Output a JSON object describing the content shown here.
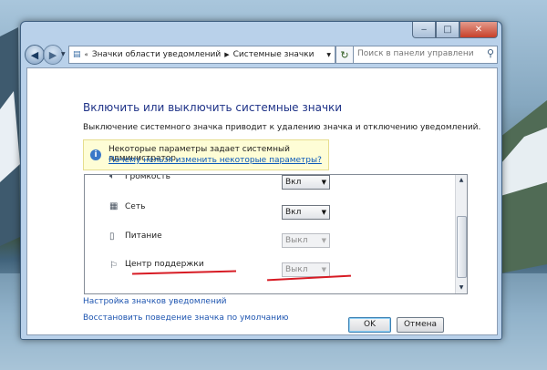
{
  "window": {
    "breadcrumb": [
      "Значки области уведомлений",
      "Системные значки"
    ],
    "search_placeholder": "Поиск в панели управления"
  },
  "page": {
    "title": "Включить или выключить системные значки",
    "description": "Выключение системного значка приводит к удалению значка и отключению уведомлений.",
    "info_text": "Некоторые параметры задает системный администратор.",
    "info_link": "Почему нельзя изменить некоторые параметры?"
  },
  "icons": {
    "volume": "speaker-icon",
    "network": "network-icon",
    "power": "battery-icon",
    "action_center": "flag-icon"
  },
  "items": [
    {
      "label": "Громкость",
      "value": "Вкл",
      "enabled": true
    },
    {
      "label": "Сеть",
      "value": "Вкл",
      "enabled": true
    },
    {
      "label": "Питание",
      "value": "Выкл",
      "enabled": false
    },
    {
      "label": "Центр поддержки",
      "value": "Выкл",
      "enabled": false
    }
  ],
  "links": {
    "configure": "Настройка значков уведомлений",
    "restore": "Восстановить поведение значка по умолчанию"
  },
  "buttons": {
    "ok": "OK",
    "cancel": "Отмена"
  },
  "colors": {
    "annotation_red": "#d71b24",
    "link_blue": "#1e55b0",
    "title_blue": "#1e3287"
  }
}
